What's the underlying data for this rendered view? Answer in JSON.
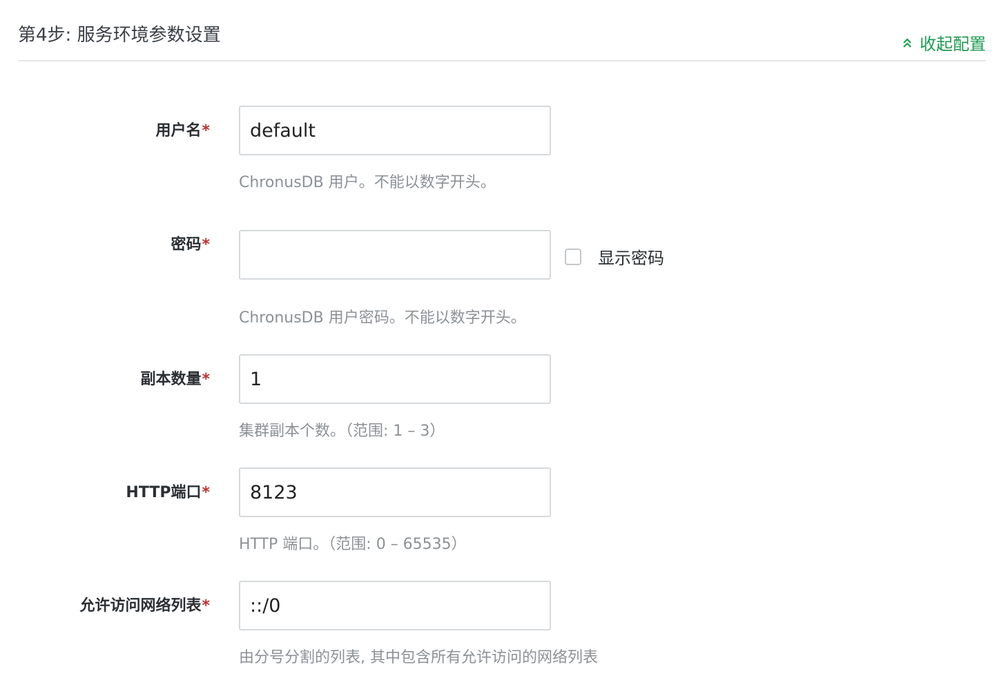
{
  "header": {
    "title": "第4步: 服务环境参数设置",
    "collapse_label": "收起配置"
  },
  "form": {
    "username": {
      "label": "用户名",
      "required": "*",
      "value": "default",
      "hint": "ChronusDB 用户。不能以数字开头。"
    },
    "password": {
      "label": "密码",
      "required": "*",
      "value": "",
      "show_password_label": "显示密码",
      "show_password_checked": false,
      "hint": "ChronusDB 用户密码。不能以数字开头。"
    },
    "replicas": {
      "label": "副本数量",
      "required": "*",
      "value": "1",
      "hint": "集群副本个数。（范围: 1 – 3）"
    },
    "http_port": {
      "label": "HTTP端口",
      "required": "*",
      "value": "8123",
      "hint": "HTTP 端口。（范围: 0 – 65535）"
    },
    "allowed_networks": {
      "label": "允许访问网络列表",
      "required": "*",
      "value": "::/0",
      "hint": "由分号分割的列表, 其中包含所有允许访问的网络列表"
    }
  },
  "colors": {
    "accent_green": "#1f9a52",
    "required_red": "#c0312d",
    "hint_gray": "#8c9196",
    "border_gray": "#d6d9dc"
  },
  "icons": {
    "collapse": "double-chevron-up-icon"
  }
}
